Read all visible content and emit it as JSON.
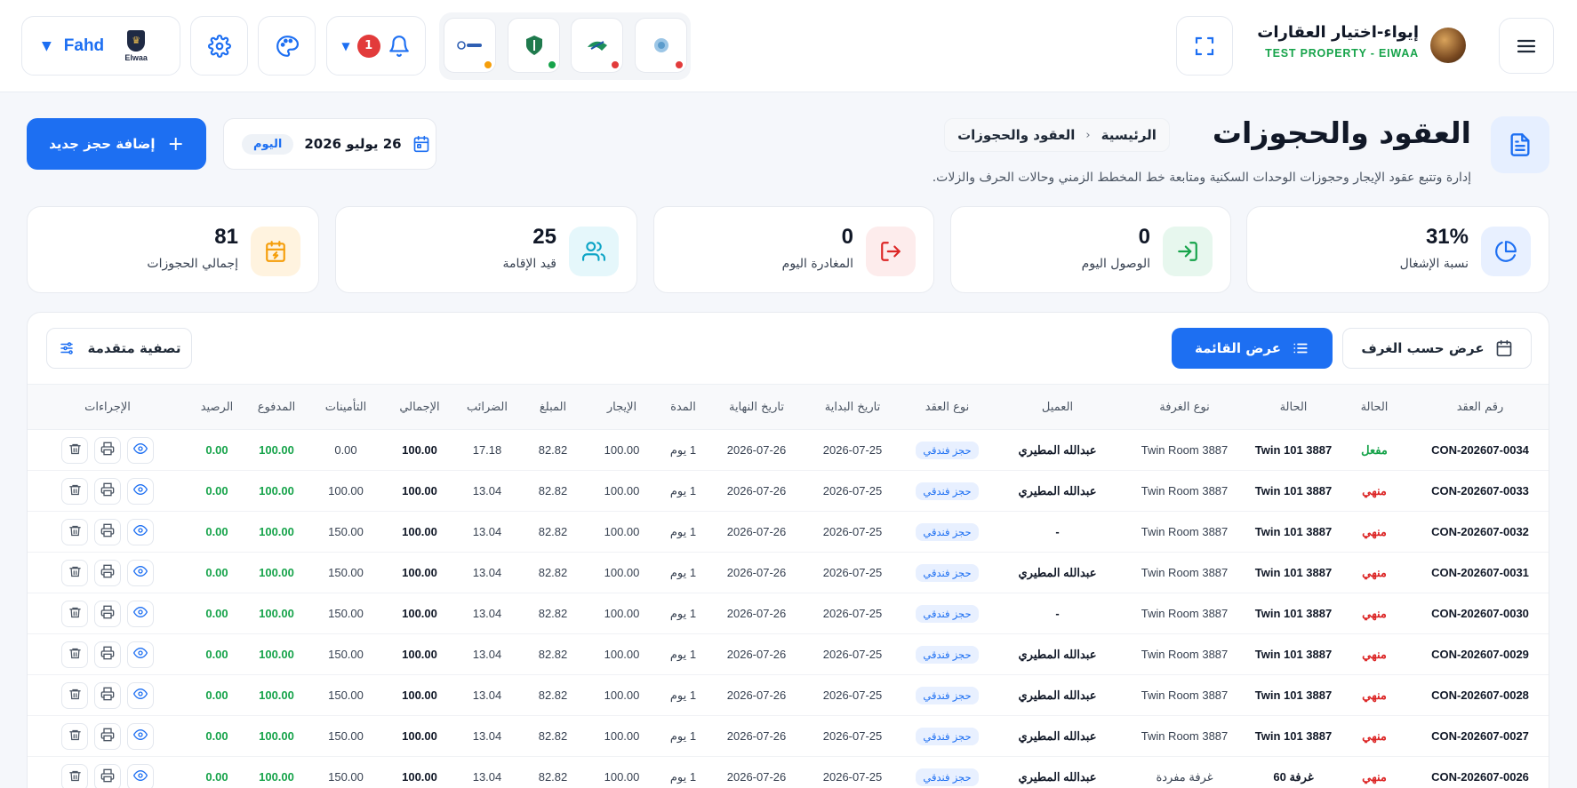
{
  "topbar": {
    "user_name": "Fahd",
    "brand_logo_text": "Elwaa",
    "notification_count": "1",
    "property_name": "إيواء-اختيار العقارات",
    "property_subtitle": "TEST PROPERTY - EIWAA",
    "apps": [
      {
        "icon": "app-logo-1",
        "status_color": "#f59e0b"
      },
      {
        "icon": "app-logo-2",
        "status_color": "#16a34a"
      },
      {
        "icon": "app-logo-3",
        "status_color": "#e23b3b"
      },
      {
        "icon": "app-logo-4",
        "status_color": "#e23b3b"
      }
    ]
  },
  "header": {
    "title": "العقود والحجوزات",
    "description": "إدارة وتتبع عقود الإيجار وحجوزات الوحدات السكنية ومتابعة خط المخطط الزمني وحالات الحرف والزلات.",
    "breadcrumb_home": "الرئيسية",
    "breadcrumb_current": "العقود والحجوزات",
    "today_label": "اليوم",
    "date": "26 يوليو 2026",
    "add_button": "إضافة حجز جديد"
  },
  "stats": [
    {
      "label": "نسبة الإشغال",
      "value": "31%",
      "icon": "pie-chart-icon",
      "color": "#1d6ff2",
      "bg": "#e8f0ff"
    },
    {
      "label": "الوصول اليوم",
      "value": "0",
      "icon": "login-icon",
      "color": "#16a34a",
      "bg": "#e7f7ee"
    },
    {
      "label": "المغادرة اليوم",
      "value": "0",
      "icon": "logout-icon",
      "color": "#dc2626",
      "bg": "#fdecec"
    },
    {
      "label": "قيد الإقامة",
      "value": "25",
      "icon": "users-icon",
      "color": "#0ea5c6",
      "bg": "#e5f7fb"
    },
    {
      "label": "إجمالي الحجوزات",
      "value": "81",
      "icon": "calendar-icon",
      "color": "#f59e0b",
      "bg": "#fff3df"
    }
  ],
  "toolbar": {
    "rooms_view": "عرض حسب الغرف",
    "list_view": "عرض القائمة",
    "advanced_filter": "تصفية متقدمة"
  },
  "table": {
    "headers": [
      "رقم العقد",
      "الحالة",
      "الحالة",
      "نوع الغرفة",
      "العميل",
      "نوع العقد",
      "تاريخ البداية",
      "تاريخ النهاية",
      "المدة",
      "الإيجار",
      "المبلغ",
      "الضرائب",
      "الإجمالي",
      "التأمينات",
      "المدفوع",
      "الرصيد",
      "الإجراءات"
    ],
    "rows": [
      {
        "contract": "CON-202607-0034",
        "status": "مفعل",
        "active": true,
        "unit": "Twin 101 3887",
        "room_type": "Twin Room 3887",
        "client": "عبدالله المطيري",
        "type": "حجز فندقي",
        "start": "2026-07-25",
        "end": "2026-07-26",
        "duration": "1 يوم",
        "rent": "100.00",
        "amount": "82.82",
        "tax": "17.18",
        "total": "100.00",
        "deposit": "0.00",
        "paid": "100.00",
        "balance": "0.00"
      },
      {
        "contract": "CON-202607-0033",
        "status": "منهي",
        "active": false,
        "unit": "Twin 101 3887",
        "room_type": "Twin Room 3887",
        "client": "عبدالله المطيري",
        "type": "حجز فندقي",
        "start": "2026-07-25",
        "end": "2026-07-26",
        "duration": "1 يوم",
        "rent": "100.00",
        "amount": "82.82",
        "tax": "13.04",
        "total": "100.00",
        "deposit": "100.00",
        "paid": "100.00",
        "balance": "0.00"
      },
      {
        "contract": "CON-202607-0032",
        "status": "منهي",
        "active": false,
        "unit": "Twin 101 3887",
        "room_type": "Twin Room 3887",
        "client": "-",
        "type": "حجز فندقي",
        "start": "2026-07-25",
        "end": "2026-07-26",
        "duration": "1 يوم",
        "rent": "100.00",
        "amount": "82.82",
        "tax": "13.04",
        "total": "100.00",
        "deposit": "150.00",
        "paid": "100.00",
        "balance": "0.00"
      },
      {
        "contract": "CON-202607-0031",
        "status": "منهي",
        "active": false,
        "unit": "Twin 101 3887",
        "room_type": "Twin Room 3887",
        "client": "عبدالله المطيري",
        "type": "حجز فندقي",
        "start": "2026-07-25",
        "end": "2026-07-26",
        "duration": "1 يوم",
        "rent": "100.00",
        "amount": "82.82",
        "tax": "13.04",
        "total": "100.00",
        "deposit": "150.00",
        "paid": "100.00",
        "balance": "0.00"
      },
      {
        "contract": "CON-202607-0030",
        "status": "منهي",
        "active": false,
        "unit": "Twin 101 3887",
        "room_type": "Twin Room 3887",
        "client": "-",
        "type": "حجز فندقي",
        "start": "2026-07-25",
        "end": "2026-07-26",
        "duration": "1 يوم",
        "rent": "100.00",
        "amount": "82.82",
        "tax": "13.04",
        "total": "100.00",
        "deposit": "150.00",
        "paid": "100.00",
        "balance": "0.00"
      },
      {
        "contract": "CON-202607-0029",
        "status": "منهي",
        "active": false,
        "unit": "Twin 101 3887",
        "room_type": "Twin Room 3887",
        "client": "عبدالله المطيري",
        "type": "حجز فندقي",
        "start": "2026-07-25",
        "end": "2026-07-26",
        "duration": "1 يوم",
        "rent": "100.00",
        "amount": "82.82",
        "tax": "13.04",
        "total": "100.00",
        "deposit": "150.00",
        "paid": "100.00",
        "balance": "0.00"
      },
      {
        "contract": "CON-202607-0028",
        "status": "منهي",
        "active": false,
        "unit": "Twin 101 3887",
        "room_type": "Twin Room 3887",
        "client": "عبدالله المطيري",
        "type": "حجز فندقي",
        "start": "2026-07-25",
        "end": "2026-07-26",
        "duration": "1 يوم",
        "rent": "100.00",
        "amount": "82.82",
        "tax": "13.04",
        "total": "100.00",
        "deposit": "150.00",
        "paid": "100.00",
        "balance": "0.00"
      },
      {
        "contract": "CON-202607-0027",
        "status": "منهي",
        "active": false,
        "unit": "Twin 101 3887",
        "room_type": "Twin Room 3887",
        "client": "عبدالله المطيري",
        "type": "حجز فندقي",
        "start": "2026-07-25",
        "end": "2026-07-26",
        "duration": "1 يوم",
        "rent": "100.00",
        "amount": "82.82",
        "tax": "13.04",
        "total": "100.00",
        "deposit": "150.00",
        "paid": "100.00",
        "balance": "0.00"
      },
      {
        "contract": "CON-202607-0026",
        "status": "منهي",
        "active": false,
        "unit": "غرفة 60",
        "room_type": "غرفة مفردة",
        "client": "عبدالله المطيري",
        "type": "حجز فندقي",
        "start": "2026-07-25",
        "end": "2026-07-26",
        "duration": "1 يوم",
        "rent": "100.00",
        "amount": "82.82",
        "tax": "13.04",
        "total": "100.00",
        "deposit": "150.00",
        "paid": "100.00",
        "balance": "0.00"
      }
    ]
  }
}
